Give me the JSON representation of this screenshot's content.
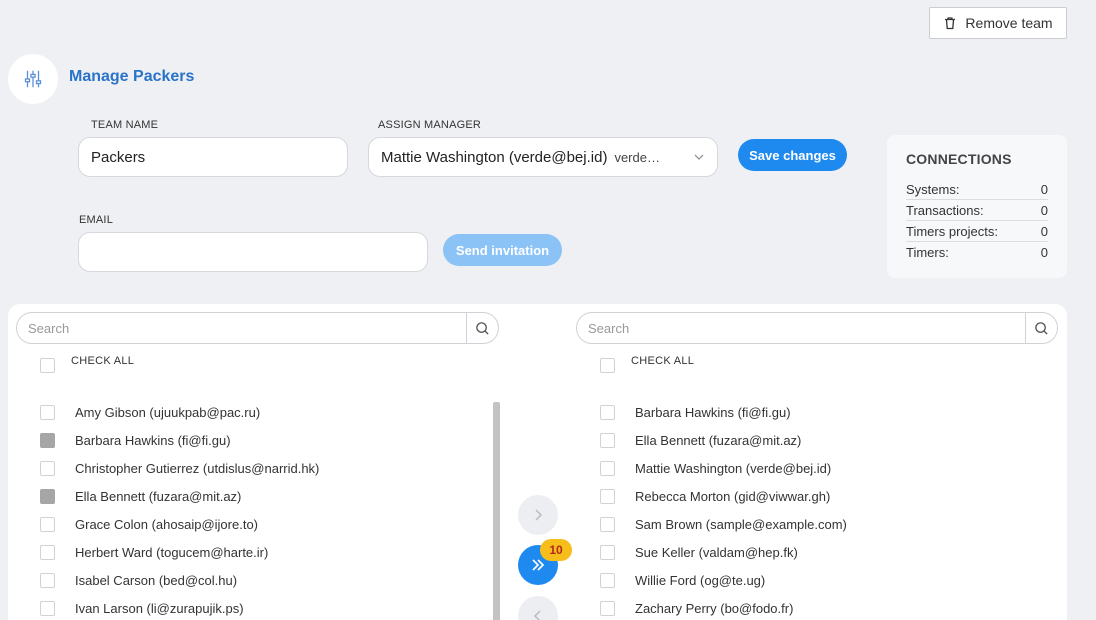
{
  "header": {
    "remove_team_label": "Remove team",
    "title": "Manage Packers"
  },
  "form": {
    "team_name_label": "TEAM NAME",
    "team_name_value": "Packers",
    "assign_manager_label": "ASSIGN MANAGER",
    "manager_selected": "Mattie Washington (verde@bej.id)",
    "manager_selected_sub": "verde@bej.id",
    "save_label": "Save changes",
    "email_label": "EMAIL",
    "email_value": "",
    "send_invitation_label": "Send invitation"
  },
  "connections": {
    "title": "CONNECTIONS",
    "rows": [
      {
        "label": "Systems:",
        "value": "0"
      },
      {
        "label": "Transactions:",
        "value": "0"
      },
      {
        "label": "Timers projects:",
        "value": "0"
      },
      {
        "label": "Timers:",
        "value": "0"
      }
    ]
  },
  "left_list": {
    "search_placeholder": "Search",
    "check_all_label": "CHECK ALL",
    "items": [
      {
        "label": "Amy Gibson (ujuukpab@pac.ru)",
        "checked": false
      },
      {
        "label": "Barbara Hawkins (fi@fi.gu)",
        "checked": true
      },
      {
        "label": "Christopher Gutierrez (utdislus@narrid.hk)",
        "checked": false
      },
      {
        "label": "Ella Bennett (fuzara@mit.az)",
        "checked": true
      },
      {
        "label": "Grace Colon (ahosaip@ijore.to)",
        "checked": false
      },
      {
        "label": "Herbert Ward (togucem@harte.ir)",
        "checked": false
      },
      {
        "label": "Isabel Carson (bed@col.hu)",
        "checked": false
      },
      {
        "label": "Ivan Larson (li@zurapujik.ps)",
        "checked": false
      }
    ]
  },
  "right_list": {
    "search_placeholder": "Search",
    "check_all_label": "CHECK ALL",
    "items": [
      {
        "label": "Barbara Hawkins (fi@fi.gu)"
      },
      {
        "label": "Ella Bennett (fuzara@mit.az)"
      },
      {
        "label": "Mattie Washington (verde@bej.id)"
      },
      {
        "label": "Rebecca Morton (gid@viwwar.gh)"
      },
      {
        "label": "Sam Brown (sample@example.com)"
      },
      {
        "label": "Sue Keller (valdam@hep.fk)"
      },
      {
        "label": "Willie Ford (og@te.ug)"
      },
      {
        "label": "Zachary Perry (bo@fodo.fr)"
      }
    ]
  },
  "transfer": {
    "move_all_count": "10"
  },
  "colors": {
    "accent": "#1e8af0",
    "title_blue": "#2a73c9",
    "badge": "#f7bd1b"
  }
}
